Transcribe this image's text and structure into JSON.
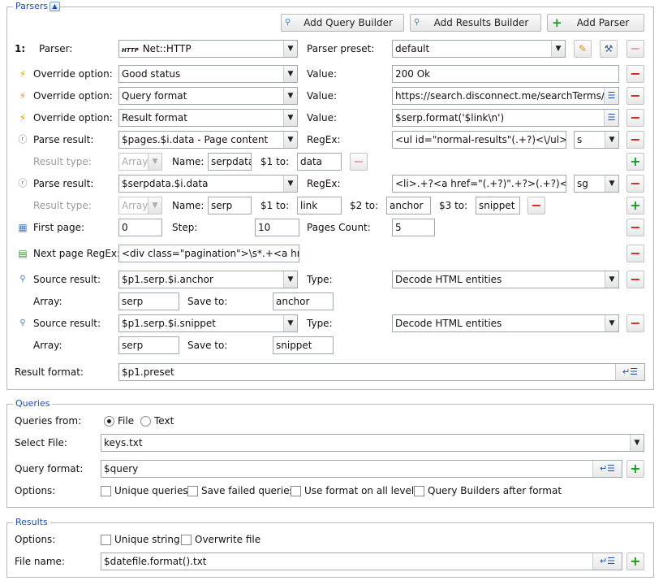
{
  "parsers": {
    "legend": "Parsers",
    "toggle_icon": "collapse-icon",
    "buttons": {
      "add_query_builder": "Add Query Builder",
      "add_results_builder": "Add Results Builder",
      "add_parser": "Add Parser"
    },
    "parser": {
      "index": "1:",
      "label": "Parser:",
      "value": "Net::HTTP",
      "preset_label": "Parser preset:",
      "preset_value": "default"
    },
    "overrides": [
      {
        "label": "Override option:",
        "option": "Good status",
        "value_label": "Value:",
        "value": "200 Ok"
      },
      {
        "label": "Override option:",
        "option": "Query format",
        "value_label": "Value:",
        "value": "https://search.disconnect.me/searchTerms/sear"
      },
      {
        "label": "Override option:",
        "option": "Result format",
        "value_label": "Value:",
        "value": "$serp.format('$link\\n')"
      }
    ],
    "parse_results": [
      {
        "label": "Parse result:",
        "source": "$pages.$i.data - Page content",
        "regex_label": "RegEx:",
        "regex": "<ul id=\"normal-results\"(.+?)<\\/ul>",
        "flags": "s",
        "type_label": "Result type:",
        "type": "Array",
        "name_label": "Name:",
        "name": "serpdata",
        "captures": [
          {
            "label": "$1 to:",
            "value": "data"
          }
        ]
      },
      {
        "label": "Parse result:",
        "source": "$serpdata.$i.data",
        "regex_label": "RegEx:",
        "regex": "<li>.+?<a href=\"(.+?)\".+?>(.+?)<.+",
        "flags": "sg",
        "type_label": "Result type:",
        "type": "Array",
        "name_label": "Name:",
        "name": "serp",
        "captures": [
          {
            "label": "$1 to:",
            "value": "link"
          },
          {
            "label": "$2 to:",
            "value": "anchor"
          },
          {
            "label": "$3 to:",
            "value": "snippet"
          }
        ]
      }
    ],
    "first_page": {
      "label": "First page:",
      "value": "0",
      "step_label": "Step:",
      "step": "10",
      "count_label": "Pages Count:",
      "count": "5"
    },
    "next_page": {
      "label": "Next page RegEx:",
      "value": "<div class=\"pagination\">\\s*.+<a href="
    },
    "source_results": [
      {
        "label": "Source result:",
        "source": "$p1.serp.$i.anchor",
        "type_label": "Type:",
        "type": "Decode HTML entities",
        "array_label": "Array:",
        "array": "serp",
        "save_label": "Save to:",
        "save": "anchor"
      },
      {
        "label": "Source result:",
        "source": "$p1.serp.$i.snippet",
        "type_label": "Type:",
        "type": "Decode HTML entities",
        "array_label": "Array:",
        "array": "serp",
        "save_label": "Save to:",
        "save": "snippet"
      }
    ],
    "result_format": {
      "label": "Result format:",
      "value": "$p1.preset"
    }
  },
  "queries": {
    "legend": "Queries",
    "from_label": "Queries from:",
    "from_options": [
      "File",
      "Text"
    ],
    "from_selected": "File",
    "file_label": "Select File:",
    "file_value": "keys.txt",
    "format_label": "Query format:",
    "format_value": "$query",
    "options_label": "Options:",
    "options": [
      "Unique queries",
      "Save failed queries",
      "Use format on all levels",
      "Query Builders after format"
    ]
  },
  "results": {
    "legend": "Results",
    "options_label": "Options:",
    "options": [
      "Unique string",
      "Overwrite file"
    ],
    "file_label": "File name:",
    "file_value": "$datefile.format().txt"
  }
}
